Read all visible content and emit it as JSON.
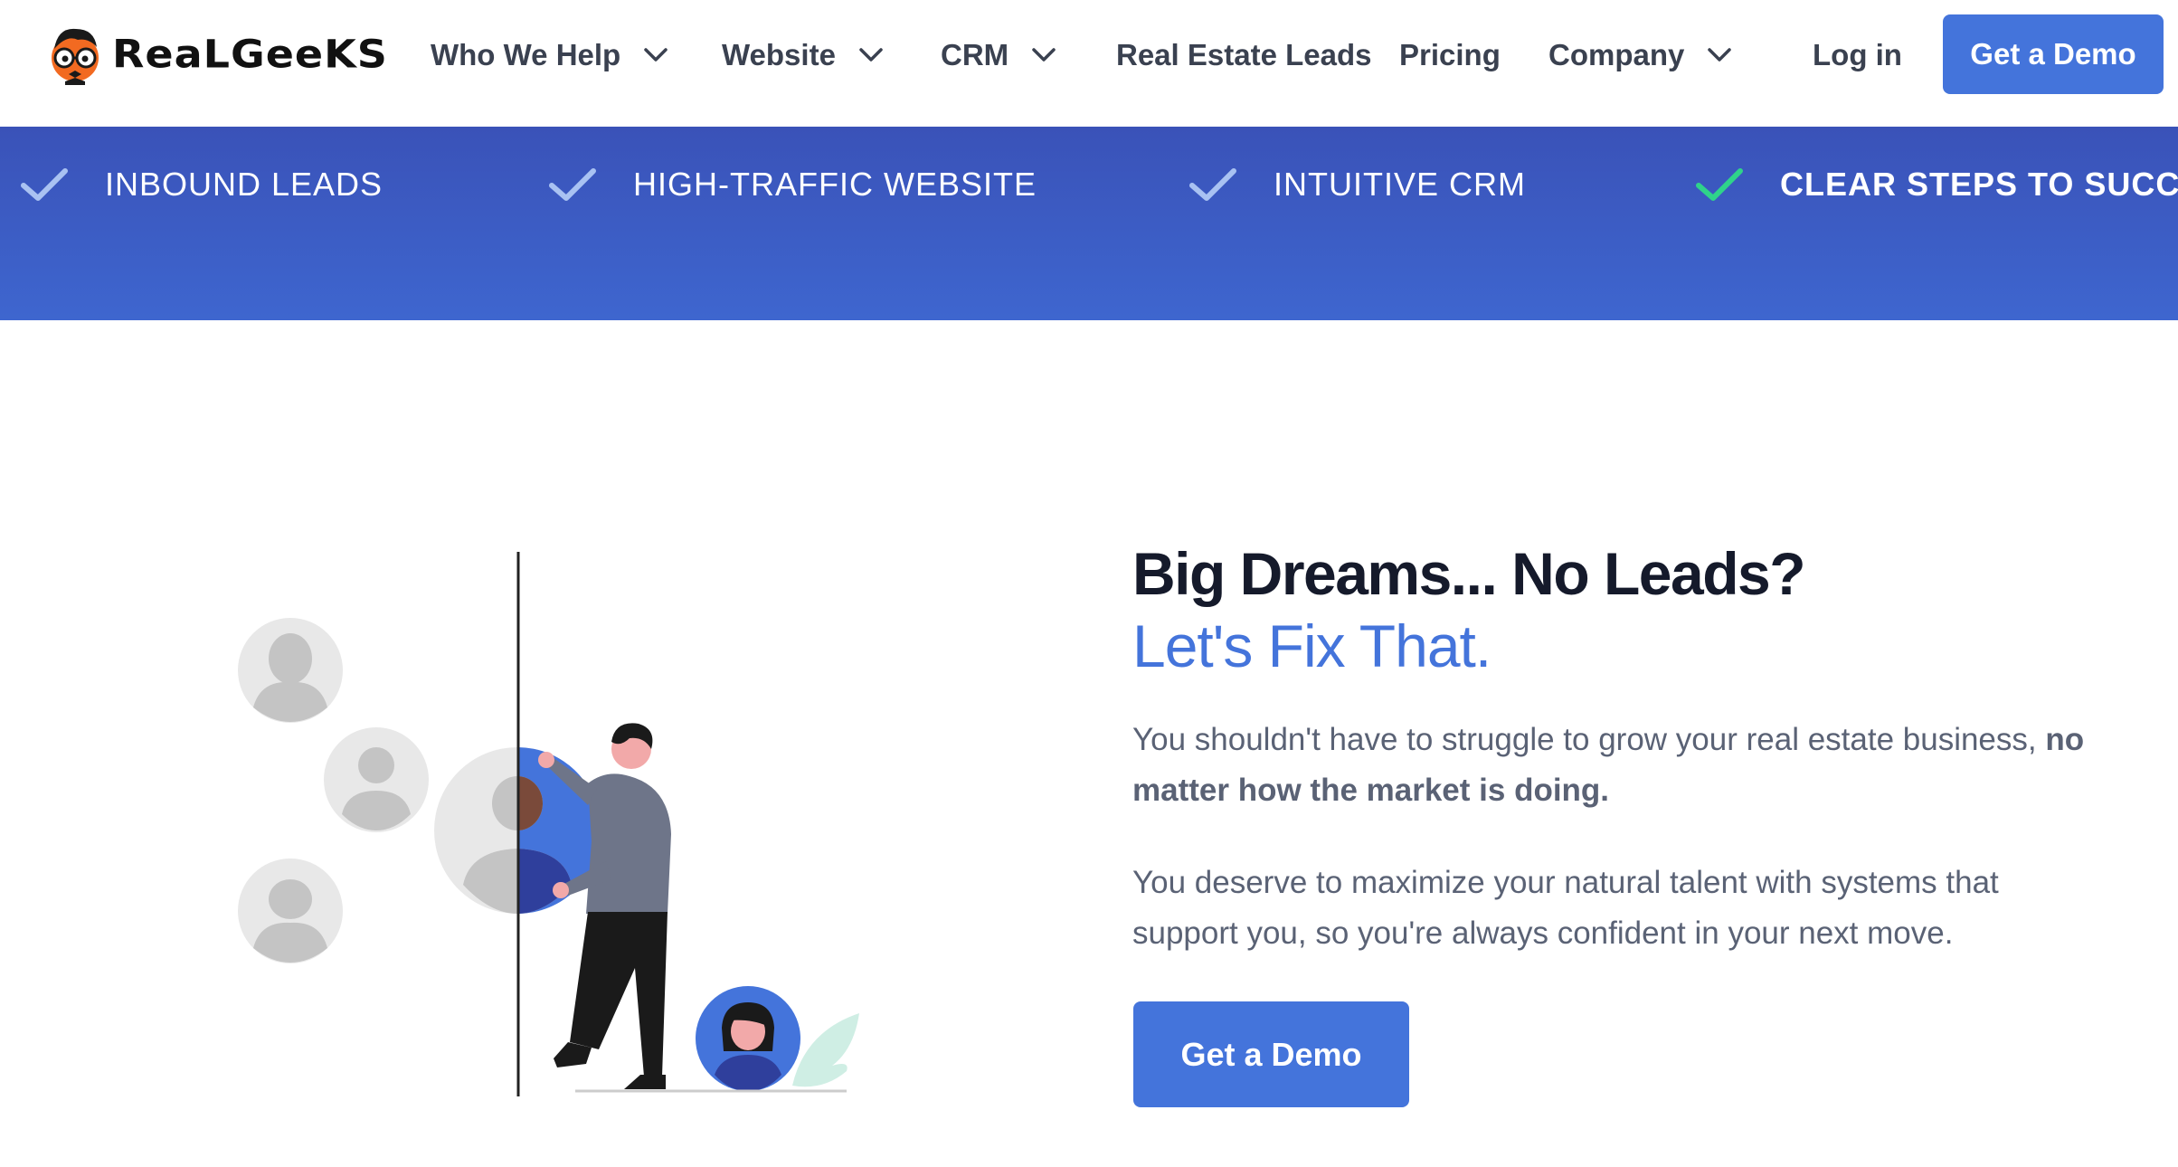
{
  "brand": {
    "name": "RealGeeks",
    "logo_text": "ReaLGeeKS"
  },
  "nav": {
    "items": [
      {
        "label": "Who We Help",
        "has_dropdown": true
      },
      {
        "label": "Website",
        "has_dropdown": true
      },
      {
        "label": "CRM",
        "has_dropdown": true
      },
      {
        "label": "Real Estate Leads",
        "has_dropdown": false
      },
      {
        "label": "Pricing",
        "has_dropdown": false
      },
      {
        "label": "Company",
        "has_dropdown": true
      }
    ],
    "login_label": "Log in",
    "demo_label": "Get a Demo"
  },
  "banner": {
    "items": [
      {
        "label": "INBOUND LEADS",
        "check_color": "#a9c2f2",
        "emphasis": false
      },
      {
        "label": "HIGH-TRAFFIC WEBSITE",
        "check_color": "#a9c2f2",
        "emphasis": false
      },
      {
        "label": "INTUITIVE CRM",
        "check_color": "#a9c2f2",
        "emphasis": false
      },
      {
        "label": "CLEAR STEPS TO SUCCESS",
        "check_color": "#2fd38a",
        "emphasis": true
      }
    ]
  },
  "hero": {
    "title": "Big Dreams... No Leads?",
    "subtitle": "Let's Fix That.",
    "paragraph1_text": "You shouldn't have to struggle to grow your real estate business, ",
    "paragraph1_bold": "no matter how the market is doing.",
    "paragraph2": "You deserve to maximize your natural talent with systems that support you, so you're always confident in your next move.",
    "cta_label": "Get a Demo"
  },
  "colors": {
    "accent": "#4474db",
    "banner_top": "#3a52b8",
    "banner_bottom": "#3e66cf",
    "heading": "#151a2b",
    "body_text": "#5a6275",
    "success_check": "#2fd38a"
  }
}
